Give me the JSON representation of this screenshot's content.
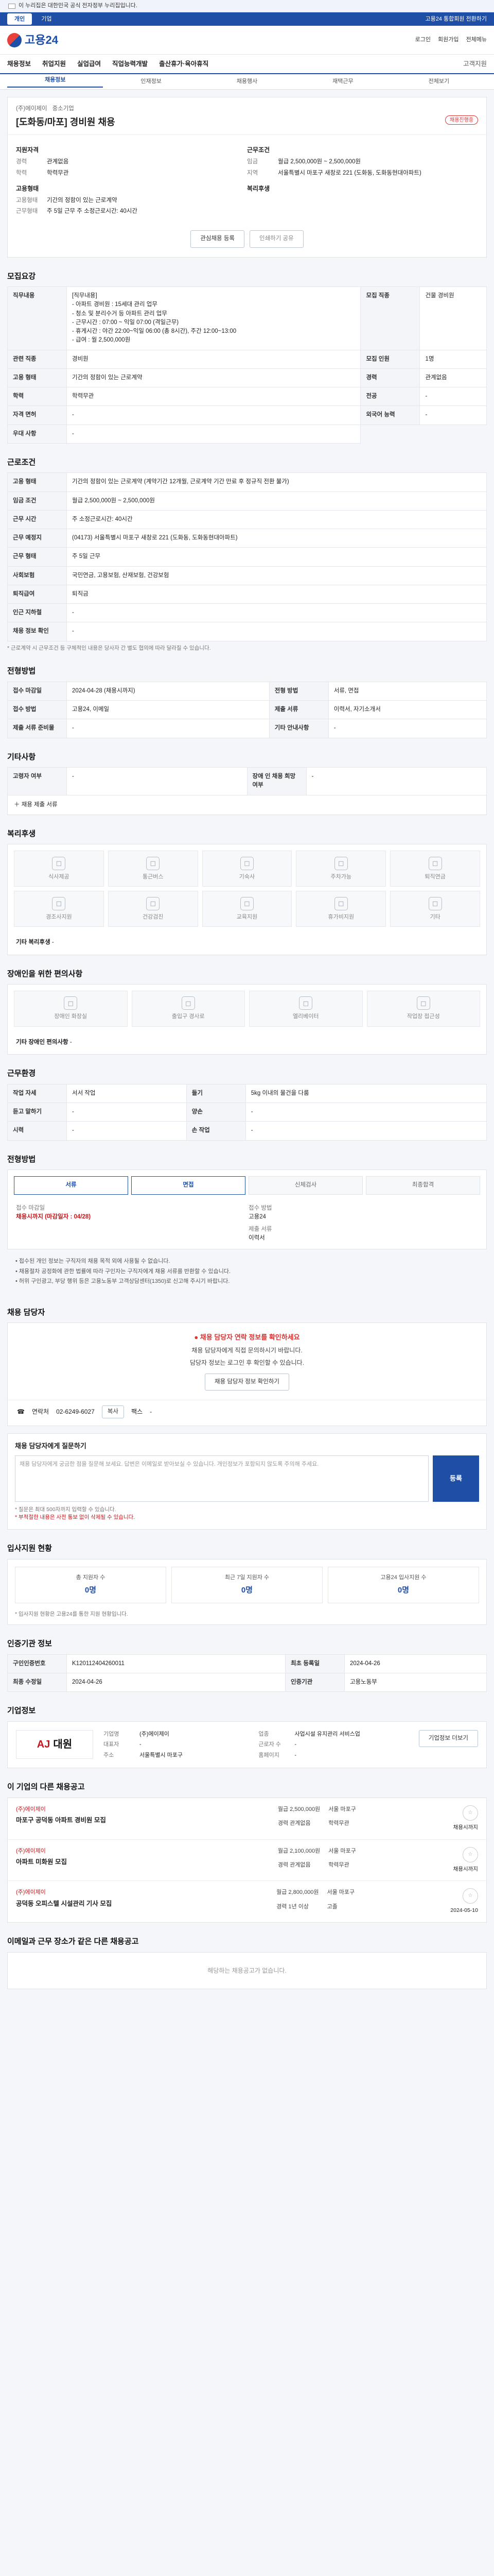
{
  "gov_banner": "이 누리집은 대한민국 공식 전자정부 누리집입니다.",
  "topbar": {
    "tabs": [
      "개인",
      "기업"
    ],
    "right": "고용24 통합회원 전환하기"
  },
  "logo": "고용24",
  "header_links": [
    "로그인",
    "회원가입",
    "전체메뉴"
  ],
  "gnb": [
    "채용정보",
    "취업지원",
    "실업급여",
    "직업능력개발",
    "출산휴가·육아휴직"
  ],
  "gnb_right": "고객지원",
  "subnav": [
    "채용정보",
    "인재정보",
    "채용행사",
    "재택근무",
    "전체보기"
  ],
  "job": {
    "company_label": "(주)에이제이",
    "company_sub": "중소기업",
    "title": "[도화동/마포] 경비원 채용",
    "badge": "채용진행중",
    "left_head": "지원자격",
    "left": [
      {
        "k": "경력",
        "v": "관계없음"
      },
      {
        "k": "학력",
        "v": "학력무관"
      }
    ],
    "right_head": "근무조건",
    "right": [
      {
        "k": "임금",
        "v": "월급 2,500,000원 ~ 2,500,000원"
      },
      {
        "k": "지역",
        "v": "서울특별시 마포구 새창로 221 (도화동, 도화동현대아파트)"
      }
    ],
    "left2_head": "고용형태",
    "left2": [
      {
        "k": "고용형태",
        "v": "기간의 정함이 있는 근로계약"
      },
      {
        "k": "근무형태",
        "v": "주 5일 근무 주 소정근로시간: 40시간"
      }
    ],
    "right2_head": "복리후생",
    "right2": [
      {
        "k": "",
        "v": ""
      }
    ],
    "btn_scrap": "관심채용 등록",
    "btn_print": "인쇄하기 공유"
  },
  "sections": {
    "recruit": "모집요강",
    "conditions": "근로조건",
    "apply": "전형방법",
    "welfare": "복리후생",
    "disabled": "장애인을 위한 편의사항",
    "manager": "채용 담당자",
    "qna": "채용 담당자에게 질문하기",
    "applicants": "입사지원 현황",
    "corp": "기업정보",
    "info": "인증기관 정보",
    "others": "이 기업의 다른 채용공고",
    "nearby": "이메일과 근무 장소가 같은 다른 채용공고"
  },
  "recruit_table": [
    {
      "k": "직무내용",
      "v": "[직무내용]\n- 아파트 경비원 : 15세대 관리 업무\n- 청소 및 분리수거 등 아파트 관리 업무\n- 근무시간 : 07:00 ~ 익일 07:00 (격일근무)\n- 휴게시간 : 야간 22:00~익일 06:00 (총 8시간), 주간 12:00~13:00\n- 급여 : 월 2,500,000원"
    },
    {
      "k": "모집 직종",
      "v": "건물 경비원"
    },
    {
      "k": "관련 직종",
      "v": "경비원"
    },
    {
      "k": "모집 인원",
      "v": "1명"
    },
    {
      "k": "고용 형태",
      "v": "기간의 정함이 있는 근로계약"
    },
    {
      "k": "경력",
      "v": "관계없음"
    },
    {
      "k": "학력",
      "v": "학력무관"
    },
    {
      "k": "전공",
      "v": "-"
    },
    {
      "k": "자격 면허",
      "v": "-"
    },
    {
      "k": "외국어 능력",
      "v": "-"
    },
    {
      "k": "우대 사항",
      "v": "-"
    }
  ],
  "condition_table": [
    {
      "k": "고용 형태",
      "v": "기간의 정함이 있는 근로계약 (계약기간 12개월, 근로계약 기간 만료 후 정규직 전환 불가)"
    },
    {
      "k": "임금 조건",
      "v": "월급 2,500,000원 ~ 2,500,000원"
    },
    {
      "k": "근무 시간",
      "v": "주 소정근로시간: 40시간"
    },
    {
      "k": "근무 예정지",
      "v": "(04173) 서울특별시 마포구 새창로 221 (도화동, 도화동현대아파트)"
    },
    {
      "k": "근무 형태",
      "v": "주 5일 근무"
    },
    {
      "k": "사회보험",
      "v": "국민연금, 고용보험, 산재보험, 건강보험"
    },
    {
      "k": "퇴직급여",
      "v": "퇴직금"
    },
    {
      "k": "인근 지하철",
      "v": "-"
    },
    {
      "k": "채용 정보 확인",
      "v": "-"
    }
  ],
  "condition_note": "* 근로계약 시 근무조건 등 구체적인 내용은 당사자 간 별도 협의에 따라 달라질 수 있습니다.",
  "apply_table": [
    {
      "k": "접수 마감일",
      "v": "2024-04-28 (채용시까지)"
    },
    {
      "k": "전형 방법",
      "v": "서류, 면접"
    },
    {
      "k": "접수 방법",
      "v": "고용24, 이메일"
    },
    {
      "k": "제출 서류",
      "v": "이력서, 자기소개서"
    },
    {
      "k": "제출 서류 준비물",
      "v": "-"
    },
    {
      "k": "기타 안내사항",
      "v": "-"
    }
  ],
  "extra_title": "기타사항",
  "extra_table": [
    {
      "k": "고령자 여부",
      "v": "-"
    },
    {
      "k": "장애 인 채용 희망 여부",
      "v": "-"
    }
  ],
  "extra_more": "채용 제출 서류",
  "welfare_items": [
    "식사제공",
    "통근버스",
    "기숙사",
    "주차가능",
    "퇴직연금",
    "경조사지원",
    "건강검진",
    "교육지원",
    "휴가비지원",
    "기타"
  ],
  "welfare_note": "기타 복리후생",
  "welfare_note_val": "-",
  "disabled_items": [
    "장애인 화장실",
    "출입구 경사로",
    "엘리베이터",
    "작업장 접근성"
  ],
  "disabled_note": "기타 장애인 편의사항",
  "disabled_note_val": "-",
  "work_title": "근무환경",
  "work_table": [
    {
      "k": "작업 자세",
      "v": "서서 작업"
    },
    {
      "k": "들기",
      "v": "5kg 이내의 물건을 다룸"
    },
    {
      "k": "듣고 말하기",
      "v": "-"
    },
    {
      "k": "양손",
      "v": "-"
    },
    {
      "k": "시력",
      "v": "-"
    },
    {
      "k": "손 작업",
      "v": "-"
    }
  ],
  "apply_steps": [
    "서류",
    "면접",
    "신체검사",
    "최종합격"
  ],
  "apply_detail": {
    "deadline_k": "접수 마감일",
    "deadline_v": "채용시까지 (마감일자 : 04/28)",
    "method_k": "접수 방법",
    "method_v": "고용24",
    "doc_k": "제출 서류",
    "doc_v": "이력서"
  },
  "apply_bullets": [
    "• 접수된 개인 정보는 구직자의 채용 목적 외에 사용될 수 없습니다.",
    "• 채용절차 공정화에 관한 법률에 따라 구인자는 구직자에게 채용 서류를 반환할 수 있습니다.",
    "• 허위 구인광고, 부당 행위 등은 고용노동부 고객상담센터(1350)로 신고해 주시기 바랍니다."
  ],
  "manager": {
    "alert": "채용 담당자 연락 정보를 확인하세요",
    "line1": "채용 담당자에게 직접 문의하시기 바랍니다.",
    "line2": "담당자 정보는 로그인 후 확인할 수 있습니다.",
    "btn": "채용 담당자 정보 확인하기",
    "tel_k": "연락처",
    "tel_v": "02-6249-6027",
    "tel_k2": "팩스",
    "tel_v2": "-",
    "copy": "복사"
  },
  "qna": {
    "placeholder": "채용 담당자에게 궁금한 점을 질문해 보세요. 답변은 이메일로 받아보실 수 있습니다. 개인정보가 포함되지 않도록 주의해 주세요.",
    "send": "등록",
    "note1": "* 질문은 최대 500자까지 입력할 수 있습니다.",
    "note2": "* 부적절한 내용은 사전 통보 없이 삭제될 수 있습니다."
  },
  "stats": [
    {
      "l": "총 지원자 수",
      "n": "0명"
    },
    {
      "l": "최근 7일 지원자 수",
      "n": "0명"
    },
    {
      "l": "고용24 입사지원 수",
      "n": "0명"
    }
  ],
  "stats_note": "* 입사지원 현황은 고용24를 통한 지원 현황입니다.",
  "info_table": [
    {
      "k": "구인인증번호",
      "v": "K120112404260011"
    },
    {
      "k": "최초 등록일",
      "v": "2024-04-26"
    },
    {
      "k": "최종 수정일",
      "v": "2024-04-26"
    },
    {
      "k": "인증기관",
      "v": "고용노동부"
    }
  ],
  "corp": {
    "logo_a": "AJ",
    "logo_b": "대원",
    "rows": [
      {
        "k": "기업명",
        "v": "(주)에이제이"
      },
      {
        "k": "업종",
        "v": "사업시설 유지관리 서비스업"
      },
      {
        "k": "대표자",
        "v": "-"
      },
      {
        "k": "근로자 수",
        "v": "-"
      },
      {
        "k": "주소",
        "v": "서울특별시 마포구"
      },
      {
        "k": "홈페이지",
        "v": "-"
      }
    ],
    "btn": "기업정보 더보기"
  },
  "others": [
    {
      "tag": "(주)에이제이",
      "title": "마포구 공덕동 아파트 경비원 모집",
      "rows": [
        "월급 2,500,000원",
        "서울 마포구",
        "경력 관계없음",
        "학력무관"
      ],
      "deadline": "채용시까지"
    },
    {
      "tag": "(주)에이제이",
      "title": "아파트 미화원 모집",
      "rows": [
        "월급 2,100,000원",
        "서울 마포구",
        "경력 관계없음",
        "학력무관"
      ],
      "deadline": "채용시까지"
    },
    {
      "tag": "(주)에이제이",
      "title": "공덕동 오피스텔 시설관리 기사 모집",
      "rows": [
        "월급 2,800,000원",
        "서울 마포구",
        "경력 1년 이상",
        "고졸"
      ],
      "deadline": "2024-05-10"
    }
  ],
  "nearby_empty": "해당하는 채용공고가 없습니다."
}
